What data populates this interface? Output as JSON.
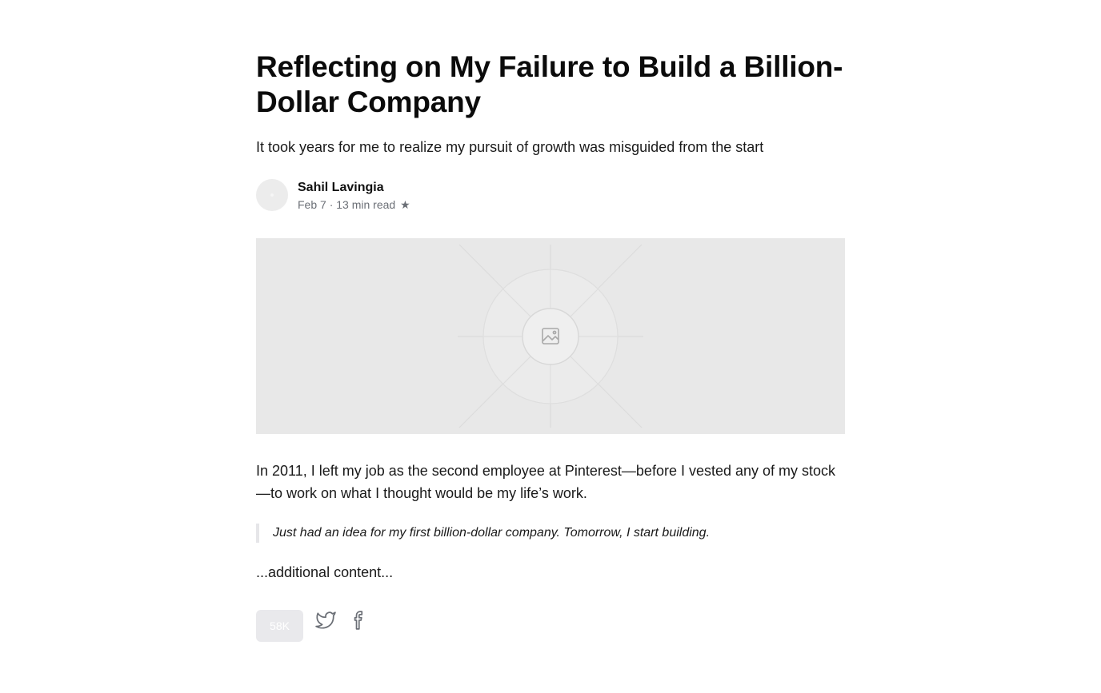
{
  "article": {
    "title": "Reflecting on My Failure to Build a Billion-Dollar Company",
    "subtitle": "It took years for me to realize my pursuit of growth was misguided from the start",
    "author": {
      "name": "Sahil Lavingia",
      "meta": "Feb 7 · 13 min read",
      "star_icon": "star-icon"
    },
    "hero_image": {
      "icon": "image-placeholder-icon",
      "background": "#e8e8e8"
    },
    "body": "In 2011, I left my job as the second employee at Pinterest—before I vested any of my stock—to work on what I thought would be my life’s work.",
    "quote": "Just had an idea for my first billion-dollar company. Tomorrow, I start building.",
    "more": "...additional content..."
  },
  "actions": {
    "clap_count": "58K",
    "share_icons": [
      "twitter-icon",
      "facebook-icon"
    ]
  },
  "colors": {
    "text": "#1a1a1a",
    "meta": "#6b6f76",
    "quote_border": "#e6e6e9",
    "button_bg": "#e9e9ec"
  }
}
